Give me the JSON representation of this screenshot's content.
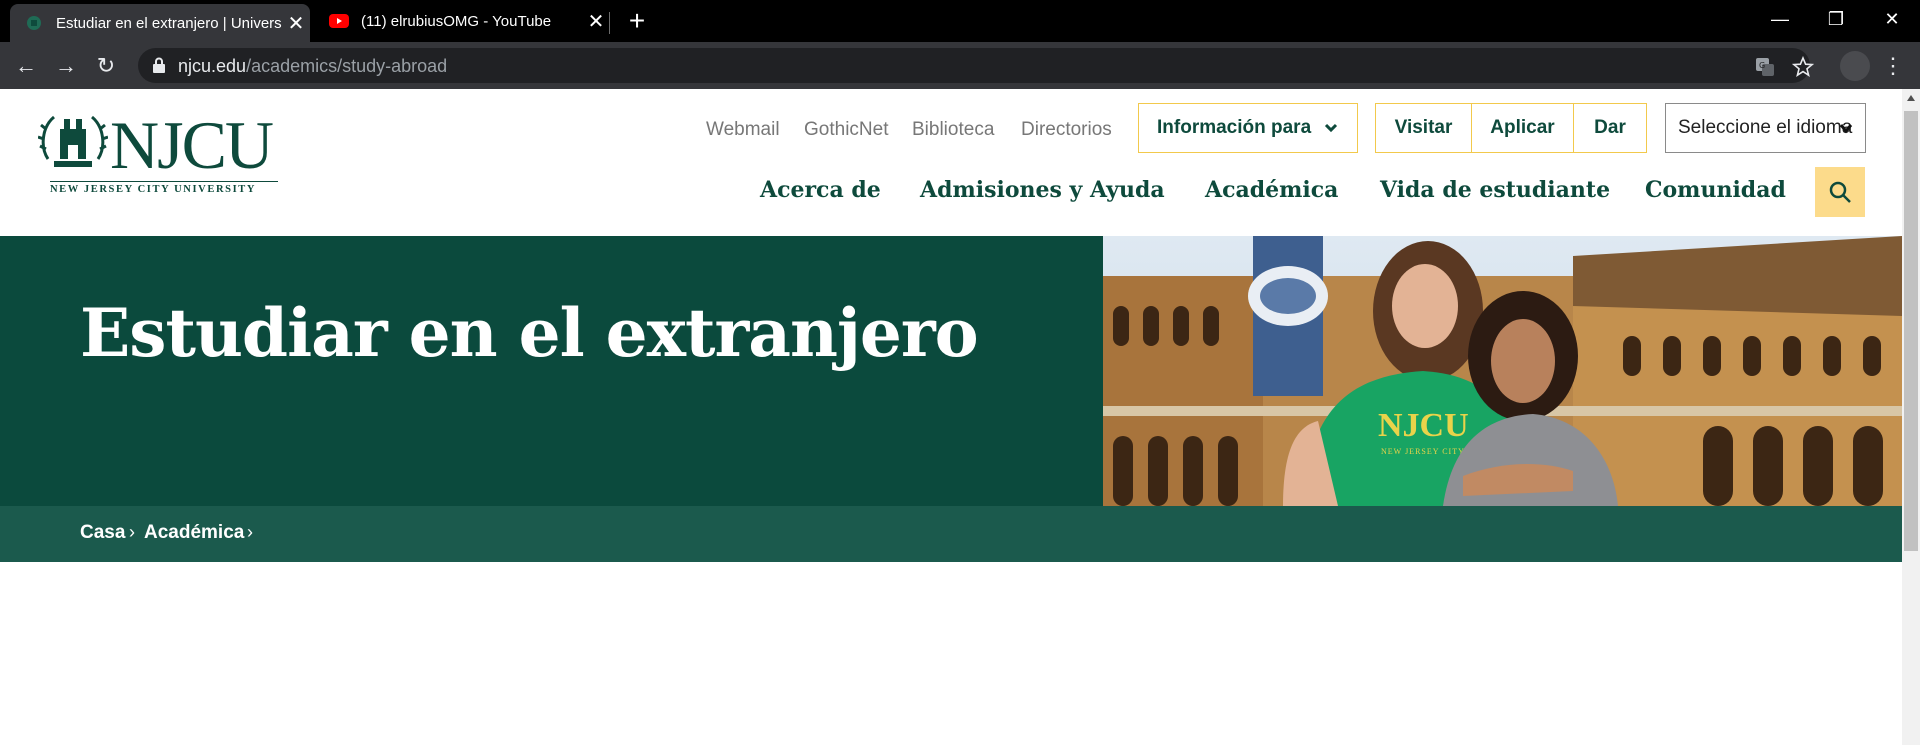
{
  "browser": {
    "tabs": [
      {
        "title": "Estudiar en el extranjero | Universi",
        "favicon": "njcu-seal-icon",
        "active": true
      },
      {
        "title": "(11) elrubiusOMG - YouTube",
        "favicon": "youtube-icon",
        "active": false
      }
    ],
    "url_host": "njcu.edu",
    "url_path": "/academics/study-abroad"
  },
  "header": {
    "logo_text": "NJCU",
    "logo_subline": "NEW JERSEY CITY UNIVERSITY",
    "utility_links": [
      "Webmail",
      "GothicNet",
      "Biblioteca",
      "Directorios"
    ],
    "info_button": "Información para",
    "cta_buttons": [
      "Visitar",
      "Aplicar",
      "Dar"
    ],
    "language_select": "Seleccione el idioma",
    "main_nav": [
      "Acerca de",
      "Admisiones y Ayuda",
      "Académica",
      "Vida de estudiante",
      "Comunidad"
    ]
  },
  "hero": {
    "title": "Estudiar en el extranjero",
    "photo_shirt_text": "NJCU",
    "photo_shirt_subtext": "NEW JERSEY CITY UNIVERSITY"
  },
  "breadcrumb": [
    "Casa",
    "Académica"
  ],
  "colors": {
    "brand_green": "#0b4a3d",
    "breadcrumb_green": "#1b5a4d",
    "accent_gold": "#f2c94c",
    "search_bg": "#fcdb8b"
  }
}
